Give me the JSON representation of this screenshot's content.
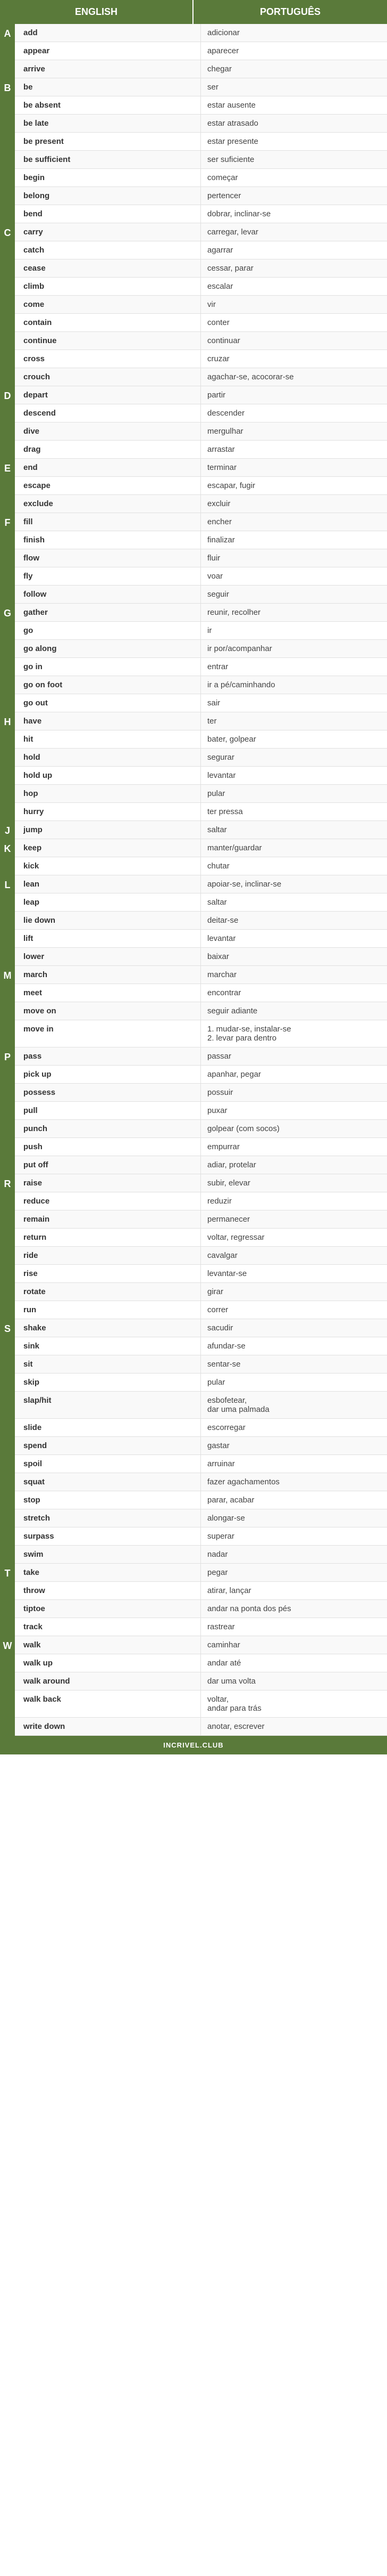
{
  "header": {
    "english": "ENGLISH",
    "portuguese": "PORTUGUÊS"
  },
  "sections": [
    {
      "letter": "A",
      "rows": [
        {
          "en": "add",
          "pt": "adicionar"
        },
        {
          "en": "appear",
          "pt": "aparecer"
        },
        {
          "en": "arrive",
          "pt": "chegar"
        }
      ]
    },
    {
      "letter": "B",
      "rows": [
        {
          "en": "be",
          "pt": "ser"
        },
        {
          "en": "be absent",
          "pt": "estar ausente"
        },
        {
          "en": "be late",
          "pt": "estar atrasado"
        },
        {
          "en": "be present",
          "pt": "estar presente"
        },
        {
          "en": "be sufficient",
          "pt": "ser suficiente"
        },
        {
          "en": "begin",
          "pt": "começar"
        },
        {
          "en": "belong",
          "pt": "pertencer"
        },
        {
          "en": "bend",
          "pt": "dobrar, inclinar-se"
        }
      ]
    },
    {
      "letter": "C",
      "rows": [
        {
          "en": "carry",
          "pt": "carregar, levar"
        },
        {
          "en": "catch",
          "pt": "agarrar"
        },
        {
          "en": "cease",
          "pt": "cessar, parar"
        },
        {
          "en": "climb",
          "pt": "escalar"
        },
        {
          "en": "come",
          "pt": "vir"
        },
        {
          "en": "contain",
          "pt": "conter"
        },
        {
          "en": "continue",
          "pt": "continuar"
        },
        {
          "en": "cross",
          "pt": "cruzar"
        },
        {
          "en": "crouch",
          "pt": "agachar-se, acocorar-se"
        }
      ]
    },
    {
      "letter": "D",
      "rows": [
        {
          "en": "depart",
          "pt": "partir"
        },
        {
          "en": "descend",
          "pt": "descender"
        },
        {
          "en": "dive",
          "pt": "mergulhar"
        },
        {
          "en": "drag",
          "pt": "arrastar"
        }
      ]
    },
    {
      "letter": "E",
      "rows": [
        {
          "en": "end",
          "pt": "terminar"
        },
        {
          "en": "escape",
          "pt": "escapar, fugir"
        },
        {
          "en": "exclude",
          "pt": "excluir"
        }
      ]
    },
    {
      "letter": "F",
      "rows": [
        {
          "en": "fill",
          "pt": "encher"
        },
        {
          "en": "finish",
          "pt": "finalizar"
        },
        {
          "en": "flow",
          "pt": "fluir"
        },
        {
          "en": "fly",
          "pt": "voar"
        },
        {
          "en": "follow",
          "pt": "seguir"
        }
      ]
    },
    {
      "letter": "G",
      "rows": [
        {
          "en": "gather",
          "pt": "reunir, recolher"
        },
        {
          "en": "go",
          "pt": "ir"
        },
        {
          "en": "go along",
          "pt": "ir por/acompanhar"
        },
        {
          "en": "go in",
          "pt": "entrar"
        },
        {
          "en": "go on foot",
          "pt": "ir a pé/caminhando"
        },
        {
          "en": "go out",
          "pt": "sair"
        }
      ]
    },
    {
      "letter": "H",
      "rows": [
        {
          "en": "have",
          "pt": "ter"
        },
        {
          "en": "hit",
          "pt": "bater, golpear"
        },
        {
          "en": "hold",
          "pt": "segurar"
        },
        {
          "en": "hold up",
          "pt": "levantar"
        },
        {
          "en": "hop",
          "pt": "pular"
        },
        {
          "en": "hurry",
          "pt": "ter pressa"
        }
      ]
    },
    {
      "letter": "J",
      "rows": [
        {
          "en": "jump",
          "pt": "saltar"
        }
      ]
    },
    {
      "letter": "K",
      "rows": [
        {
          "en": "keep",
          "pt": "manter/guardar"
        },
        {
          "en": "kick",
          "pt": "chutar"
        }
      ]
    },
    {
      "letter": "L",
      "rows": [
        {
          "en": "lean",
          "pt": "apoiar-se, inclinar-se"
        },
        {
          "en": "leap",
          "pt": "saltar"
        },
        {
          "en": "lie down",
          "pt": "deitar-se"
        },
        {
          "en": "lift",
          "pt": "levantar"
        },
        {
          "en": "lower",
          "pt": "baixar"
        }
      ]
    },
    {
      "letter": "M",
      "rows": [
        {
          "en": "march",
          "pt": "marchar"
        },
        {
          "en": "meet",
          "pt": "encontrar"
        },
        {
          "en": "move on",
          "pt": "seguir adiante"
        },
        {
          "en": "move in",
          "pt": "1. mudar-se, instalar-se\n2. levar para dentro"
        }
      ]
    },
    {
      "letter": "P",
      "rows": [
        {
          "en": "pass",
          "pt": "passar"
        },
        {
          "en": "pick up",
          "pt": "apanhar, pegar"
        },
        {
          "en": "possess",
          "pt": "possuir"
        },
        {
          "en": "pull",
          "pt": "puxar"
        },
        {
          "en": "punch",
          "pt": "golpear (com socos)"
        },
        {
          "en": "push",
          "pt": "empurrar"
        },
        {
          "en": "put off",
          "pt": "adiar, protelar"
        }
      ]
    },
    {
      "letter": "R",
      "rows": [
        {
          "en": "raise",
          "pt": "subir, elevar"
        },
        {
          "en": "reduce",
          "pt": "reduzir"
        },
        {
          "en": "remain",
          "pt": "permanecer"
        },
        {
          "en": "return",
          "pt": "voltar, regressar"
        },
        {
          "en": "ride",
          "pt": "cavalgar"
        },
        {
          "en": "rise",
          "pt": "levantar-se"
        },
        {
          "en": "rotate",
          "pt": "girar"
        },
        {
          "en": "run",
          "pt": "correr"
        }
      ]
    },
    {
      "letter": "S",
      "rows": [
        {
          "en": "shake",
          "pt": "sacudir"
        },
        {
          "en": "sink",
          "pt": "afundar-se"
        },
        {
          "en": "sit",
          "pt": "sentar-se"
        },
        {
          "en": "skip",
          "pt": "pular"
        },
        {
          "en": "slap/hit",
          "pt": "esbofetear,\ndar uma palmada"
        },
        {
          "en": "slide",
          "pt": "escorregar"
        },
        {
          "en": "spend",
          "pt": "gastar"
        },
        {
          "en": "spoil",
          "pt": "arruinar"
        },
        {
          "en": "squat",
          "pt": "fazer agachamentos"
        },
        {
          "en": "stop",
          "pt": "parar, acabar"
        },
        {
          "en": "stretch",
          "pt": "alongar-se"
        },
        {
          "en": "surpass",
          "pt": "superar"
        },
        {
          "en": "swim",
          "pt": "nadar"
        }
      ]
    },
    {
      "letter": "T",
      "rows": [
        {
          "en": "take",
          "pt": "pegar"
        },
        {
          "en": "throw",
          "pt": "atirar, lançar"
        },
        {
          "en": "tiptoe",
          "pt": "andar na ponta dos pés"
        },
        {
          "en": "track",
          "pt": "rastrear"
        }
      ]
    },
    {
      "letter": "W",
      "rows": [
        {
          "en": "walk",
          "pt": "caminhar"
        },
        {
          "en": "walk up",
          "pt": "andar até"
        },
        {
          "en": "walk around",
          "pt": "dar uma volta"
        },
        {
          "en": "walk back",
          "pt": "voltar,\nandar para trás"
        },
        {
          "en": "write down",
          "pt": "anotar, escrever"
        }
      ]
    }
  ],
  "footer": {
    "label": "INCRIVEL.CLUB"
  }
}
